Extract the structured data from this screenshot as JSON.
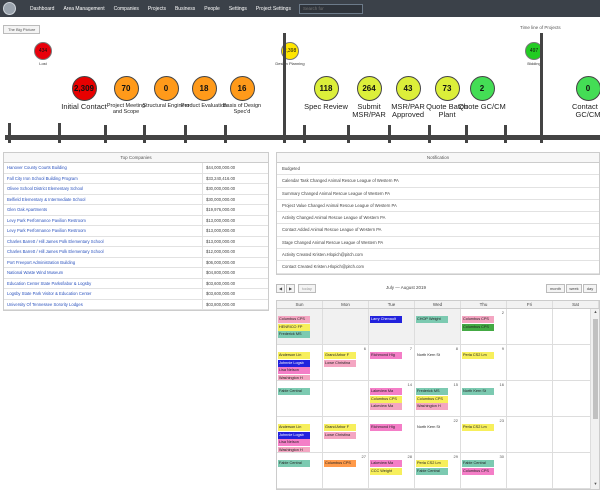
{
  "nav": {
    "items": [
      "Dashboard",
      "Area Management",
      "Companies",
      "Projects",
      "Business",
      "People",
      "Settings",
      "Project Settings"
    ],
    "search_placeholder": "Search for"
  },
  "breadcrumb": "The Big Picture",
  "timeline": {
    "title": "Time line of Projects",
    "top_indicators": [
      {
        "value": "434",
        "label": "Lost",
        "color": "#e8000b"
      },
      {
        "value": "2,398",
        "label": "Design Planning",
        "color": "#ffe600"
      },
      {
        "value": "497",
        "label": "Bidding",
        "color": "#22cc22"
      }
    ],
    "stages": [
      {
        "value": "2,309",
        "label": "Initial Contact",
        "color": "#e80000",
        "size": "big"
      },
      {
        "value": "70",
        "label": "Project Meeting and Scope",
        "color": "#ff9a1a",
        "size": "small"
      },
      {
        "value": "0",
        "label": "Structural Engineer",
        "color": "#ff9a1a",
        "size": "small"
      },
      {
        "value": "18",
        "label": "Product Evaluation",
        "color": "#ff9a1a",
        "size": "small"
      },
      {
        "value": "16",
        "label": "Basis of Design Spec'd",
        "color": "#ff9a1a",
        "size": "small"
      },
      {
        "value": "118",
        "label": "Spec Review",
        "color": "#dcef3a",
        "size": "big"
      },
      {
        "value": "264",
        "label": "Submit MSR/PAR",
        "color": "#dcef3a",
        "size": "big"
      },
      {
        "value": "43",
        "label": "MSR/PAR Approved",
        "color": "#dcef3a",
        "size": "big"
      },
      {
        "value": "73",
        "label": "Quote Batch Plant",
        "color": "#dcef3a",
        "size": "big"
      },
      {
        "value": "2",
        "label": "Quote GC/CM",
        "color": "#44dd55",
        "size": "big"
      },
      {
        "value": "0",
        "label": "Contact L GC/CM",
        "color": "#44dd55",
        "size": "big"
      }
    ]
  },
  "top_companies": {
    "title": "Top Companies",
    "rows": [
      {
        "name": "Hanover County Courts Building",
        "value": "$44,000,000.00"
      },
      {
        "name": "Fall City Iron School Building Program",
        "value": "$33,240,416.00"
      },
      {
        "name": "Olivee School District Elementary School",
        "value": "$30,000,000.00"
      },
      {
        "name": "Belfield Elementary & Intermediate School",
        "value": "$30,000,000.00"
      },
      {
        "name": "Glen Oak Apartments",
        "value": "$19,976,000.00"
      },
      {
        "name": "Levy Park Performance Pavilion Restroom",
        "value": "$13,000,000.00"
      },
      {
        "name": "Levy Park Performance Pavilion Restroom",
        "value": "$13,000,000.00"
      },
      {
        "name": "Charles Barrett / Hill James Polk Elementary School",
        "value": "$13,000,000.00"
      },
      {
        "name": "Charles Barrett / Hill James Polk Elementary School",
        "value": "$12,000,000.00"
      },
      {
        "name": "Port Freeport Administration Building",
        "value": "$06,000,000.00"
      },
      {
        "name": "National Waste Wind Museum",
        "value": "$04,800,000.00"
      },
      {
        "name": "Education Center State Parks/labor & Logsby",
        "value": "$03,600,000.00"
      },
      {
        "name": "Logsby State Park Visitor & Education Center",
        "value": "$03,600,000.00"
      },
      {
        "name": "University Of Tennessee Sorority Lodges",
        "value": "$03,800,000.00"
      }
    ]
  },
  "notification": {
    "title": "Notification",
    "rows": [
      "Budgeted",
      "Calendar Task Changed Animal Rescue League of Western PA",
      "Summary Changed Animal Rescue League of Western PA",
      "Project Value Changed Animal Rescue League of Western PA",
      "Activity Changed Animal Rescue League of Western PA",
      "Contact Added Animal Rescue League of Western PA",
      "Stage Changed Animal Rescue League of Western PA",
      "Activity Created Kristen.Hlopich@pitch.com",
      "Contact Created Kristen.Hlopich@pitch.com"
    ]
  },
  "calendar": {
    "title": "July — August 2019",
    "today": "today",
    "views": [
      "month",
      "week",
      "day"
    ],
    "days": [
      "Sun",
      "Mon",
      "Tue",
      "Wed",
      "Thu",
      "Fri",
      "Sat"
    ],
    "weeks": [
      [
        {
          "n": "",
          "g": true
        },
        {
          "n": "",
          "g": true
        },
        {
          "n": "",
          "g": true
        },
        {
          "n": "",
          "g": true
        },
        {
          "n": "2"
        },
        {
          "n": ""
        },
        {
          "n": ""
        }
      ],
      [
        {
          "n": ""
        },
        {
          "n": "6"
        },
        {
          "n": "7"
        },
        {
          "n": "8"
        },
        {
          "n": "9"
        },
        {
          "n": ""
        },
        {
          "n": ""
        }
      ],
      [
        {
          "n": ""
        },
        {
          "n": ""
        },
        {
          "n": "14"
        },
        {
          "n": "15"
        },
        {
          "n": "16"
        },
        {
          "n": ""
        },
        {
          "n": ""
        }
      ],
      [
        {
          "n": ""
        },
        {
          "n": ""
        },
        {
          "n": ""
        },
        {
          "n": "22"
        },
        {
          "n": "23"
        },
        {
          "n": ""
        },
        {
          "n": ""
        }
      ],
      [
        {
          "n": ""
        },
        {
          "n": "27"
        },
        {
          "n": "28"
        },
        {
          "n": "29"
        },
        {
          "n": "30"
        },
        {
          "n": ""
        },
        {
          "n": ""
        }
      ]
    ],
    "events": [
      {
        "w": 0,
        "d": 0,
        "r": 0,
        "t": "Columbus CPS",
        "c": "#f4a6c2"
      },
      {
        "w": 0,
        "d": 0,
        "r": 1,
        "t": "HENRICO FP",
        "c": "#f7ef5c"
      },
      {
        "w": 0,
        "d": 0,
        "r": 2,
        "t": "Frederick MS",
        "c": "#7ccab1"
      },
      {
        "w": 0,
        "d": 2,
        "r": 0,
        "t": "Larry Chenault",
        "c": "#2222dd"
      },
      {
        "w": 0,
        "d": 3,
        "r": 0,
        "t": "CHOP Weight",
        "c": "#7ccab1"
      },
      {
        "w": 0,
        "d": 4,
        "r": 0,
        "t": "Columbus CPS",
        "c": "#f4a6c2"
      },
      {
        "w": 0,
        "d": 4,
        "r": 1,
        "t": "Columbus CPS",
        "c": "#44aa44"
      },
      {
        "w": 1,
        "d": 0,
        "r": 0,
        "t": "Anderson Lin",
        "c": "#f7ef5c"
      },
      {
        "w": 1,
        "d": 0,
        "r": 1,
        "t": "Johnnie Logsb",
        "c": "#2222dd"
      },
      {
        "w": 1,
        "d": 0,
        "r": 2,
        "t": "Lisa Nelson",
        "c": "#f47ec7"
      },
      {
        "w": 1,
        "d": 0,
        "r": 3,
        "t": "Washington H",
        "c": "#f4a6c2"
      },
      {
        "w": 1,
        "d": 1,
        "r": 0,
        "t": "Grand Arbor F",
        "c": "#f7ef5c"
      },
      {
        "w": 1,
        "d": 1,
        "r": 1,
        "t": "Lowe Christina",
        "c": "#f4a6c2"
      },
      {
        "w": 1,
        "d": 2,
        "r": 0,
        "t": "Richmond Hig",
        "c": "#f47ec7"
      },
      {
        "w": 1,
        "d": 3,
        "r": 0,
        "t": "North Kern St",
        "c": "#ffffff"
      },
      {
        "w": 1,
        "d": 4,
        "r": 0,
        "t": "Perla CS2 Lm",
        "c": "#f7ef5c"
      },
      {
        "w": 2,
        "d": 0,
        "r": 0,
        "t": "Fable Central",
        "c": "#7ccab1"
      },
      {
        "w": 2,
        "d": 2,
        "r": 0,
        "t": "Lakeview Ma",
        "c": "#f47ec7"
      },
      {
        "w": 2,
        "d": 2,
        "r": 1,
        "t": "Columbus CPS",
        "c": "#f7ef5c"
      },
      {
        "w": 2,
        "d": 2,
        "r": 2,
        "t": "Lakeview Ma",
        "c": "#f4a6c2"
      },
      {
        "w": 2,
        "d": 3,
        "r": 0,
        "t": "Frederick MS",
        "c": "#7ccab1"
      },
      {
        "w": 2,
        "d": 3,
        "r": 1,
        "t": "Columbus CPS",
        "c": "#f7ef5c"
      },
      {
        "w": 2,
        "d": 3,
        "r": 2,
        "t": "Washington H",
        "c": "#f4a6c2"
      },
      {
        "w": 2,
        "d": 4,
        "r": 0,
        "t": "North Kern St",
        "c": "#7ccab1"
      },
      {
        "w": 3,
        "d": 0,
        "r": 0,
        "t": "Anderson Lin",
        "c": "#f7ef5c"
      },
      {
        "w": 3,
        "d": 0,
        "r": 1,
        "t": "Johnnie Logsb",
        "c": "#2222dd"
      },
      {
        "w": 3,
        "d": 0,
        "r": 2,
        "t": "Lisa Nelson",
        "c": "#f47ec7"
      },
      {
        "w": 3,
        "d": 0,
        "r": 3,
        "t": "Washington H",
        "c": "#f4a6c2"
      },
      {
        "w": 3,
        "d": 1,
        "r": 0,
        "t": "Grand Arbor F",
        "c": "#f7ef5c"
      },
      {
        "w": 3,
        "d": 1,
        "r": 1,
        "t": "Lowe Christina",
        "c": "#f4a6c2"
      },
      {
        "w": 3,
        "d": 2,
        "r": 0,
        "t": "Richmond Hig",
        "c": "#f47ec7"
      },
      {
        "w": 3,
        "d": 3,
        "r": 0,
        "t": "North Kern St",
        "c": "#ffffff"
      },
      {
        "w": 3,
        "d": 4,
        "r": 0,
        "t": "Perla CS2 Lm",
        "c": "#f7ef5c"
      },
      {
        "w": 4,
        "d": 0,
        "r": 0,
        "t": "Fable Central",
        "c": "#7ccab1"
      },
      {
        "w": 4,
        "d": 1,
        "r": 0,
        "t": "Columbus CPS",
        "c": "#ff9a4a"
      },
      {
        "w": 4,
        "d": 2,
        "r": 0,
        "t": "Lakeview Ma",
        "c": "#f47ec7"
      },
      {
        "w": 4,
        "d": 2,
        "r": 1,
        "t": "CCC Weight",
        "c": "#f7ef5c"
      },
      {
        "w": 4,
        "d": 3,
        "r": 0,
        "t": "Perla CS2 Lm",
        "c": "#f7ef5c"
      },
      {
        "w": 4,
        "d": 3,
        "r": 1,
        "t": "Fable Central",
        "c": "#7ccab1"
      },
      {
        "w": 4,
        "d": 4,
        "r": 0,
        "t": "Fable Central",
        "c": "#7ccab1"
      },
      {
        "w": 4,
        "d": 4,
        "r": 1,
        "t": "Columbus CPS",
        "c": "#f47ec7"
      }
    ]
  }
}
